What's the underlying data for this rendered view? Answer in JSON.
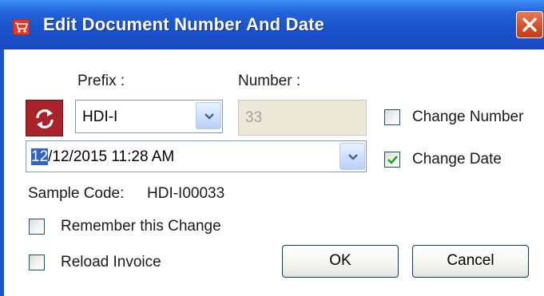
{
  "window": {
    "title": "Edit Document Number And Date",
    "title_icon": "cart-icon",
    "close_icon": "close-icon"
  },
  "labels": {
    "prefix": "Prefix :",
    "number": "Number :"
  },
  "prefix": {
    "selected": "HDI-I"
  },
  "number": {
    "value": "33",
    "enabled": false
  },
  "date": {
    "selected_part": "12",
    "rest": "/12/2015 11:28 AM"
  },
  "checkboxes": {
    "change_number": {
      "label": "Change Number",
      "checked": false
    },
    "change_date": {
      "label": "Change Date",
      "checked": true
    },
    "remember": {
      "label": "Remember this Change",
      "checked": false
    },
    "reload": {
      "label": "Reload Invoice",
      "checked": false
    }
  },
  "sample": {
    "label": "Sample Code:",
    "value": "HDI-I00033"
  },
  "buttons": {
    "ok": "OK",
    "cancel": "Cancel"
  },
  "colors": {
    "titlebar": "#2262d8",
    "close_button": "#d7532e",
    "swap_button": "#a8242a",
    "check_mark": "#21a121"
  }
}
